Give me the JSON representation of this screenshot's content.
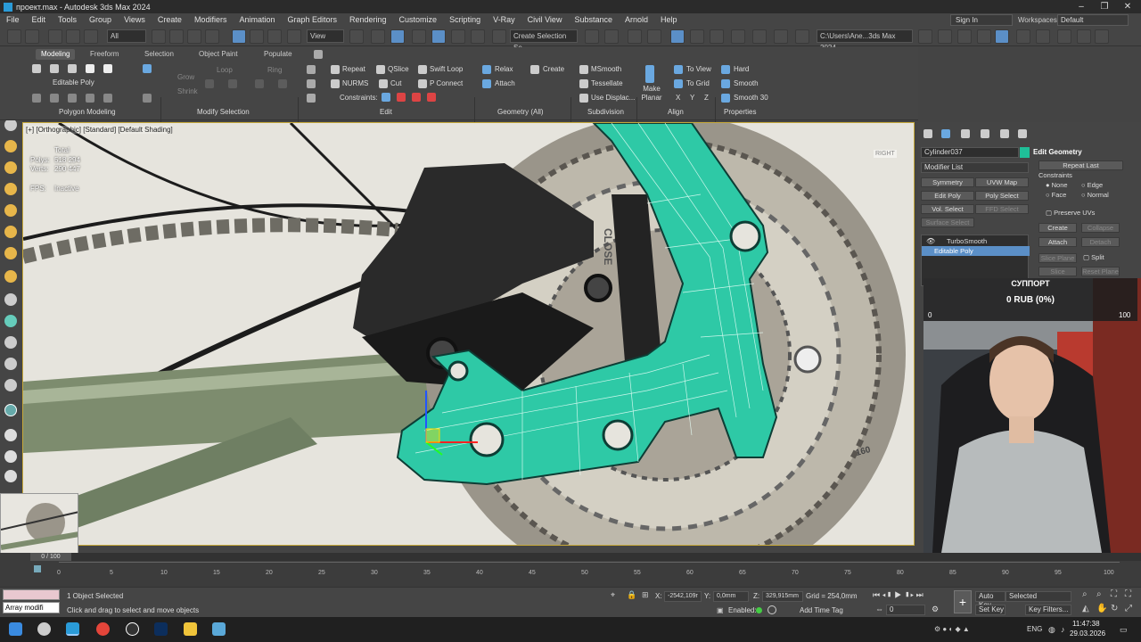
{
  "window": {
    "title": "проект.max - Autodesk 3ds Max 2024",
    "minimize": "–",
    "restore": "❐",
    "close": "✕"
  },
  "menu": [
    "File",
    "Edit",
    "Tools",
    "Group",
    "Views",
    "Create",
    "Modifiers",
    "Animation",
    "Graph Editors",
    "Rendering",
    "Customize",
    "Scripting",
    "V-Ray",
    "Civil View",
    "Substance",
    "Arnold",
    "Help"
  ],
  "account": {
    "sign_in": "Sign In",
    "workspaces_label": "Workspaces:",
    "workspace": "Default"
  },
  "toolbar": {
    "selection_filter": "All",
    "ref_coord": "View",
    "named_selection": "Create Selection Se",
    "project_path": "C:\\Users\\Ane...3ds Max 2024"
  },
  "ribbon": {
    "tabs": [
      "Modeling",
      "Freeform",
      "Selection",
      "Object Paint",
      "Populate"
    ],
    "polygon_modeling": {
      "object_type": "Editable Poly",
      "section": "Polygon Modeling"
    },
    "modify_selection": {
      "grow": "Grow",
      "shrink": "Shrink",
      "loop": "Loop",
      "ring": "Ring",
      "section": "Modify Selection"
    },
    "edit": {
      "repeat": "Repeat",
      "qslice": "QSlice",
      "swift_loop": "Swift Loop",
      "nurms": "NURMS",
      "cut": "Cut",
      "p_connect": "P Connect",
      "constraints": "Constraints:",
      "section": "Edit"
    },
    "geometry": {
      "relax": "Relax",
      "create": "Create",
      "attach": "Attach",
      "section": "Geometry (All)"
    },
    "subdivision": {
      "msmooth": "MSmooth",
      "tessellate": "Tessellate",
      "use_displac": "Use Displac...",
      "section": "Subdivision"
    },
    "align": {
      "make_planar": "Make Planar",
      "to_view": "To View",
      "to_grid": "To Grid",
      "x": "X",
      "y": "Y",
      "z": "Z",
      "section": "Align"
    },
    "properties": {
      "hard": "Hard",
      "smooth": "Smooth",
      "smooth30": "Smooth 30",
      "section": "Properties"
    }
  },
  "viewport": {
    "label": "[+] [Orthographic] [Standard] [Default Shading]",
    "stats": {
      "total": "Total",
      "polys_label": "Polys:",
      "polys": "518 294",
      "verts_label": "Verts:",
      "verts": "290 447",
      "fps_label": "FPS:",
      "fps": "Inactive"
    },
    "viewcube": "RIGHT",
    "part_text": "CLOSE",
    "cog_text": "160"
  },
  "command_panel": {
    "object_name": "Cylinder037",
    "modifier_list": "Modifier List",
    "buttons": [
      "Symmetry",
      "UVW Map",
      "Edit Poly",
      "Poly Select",
      "Vol. Select",
      "FFD Select",
      "Surface Select"
    ],
    "stack": [
      {
        "label": "TurboSmooth",
        "selected": false
      },
      {
        "label": "Editable Poly",
        "selected": true
      }
    ],
    "rollout": {
      "title": "Edit Geometry",
      "repeat_last": "Repeat Last",
      "constraints": "Constraints",
      "none": "None",
      "edge": "Edge",
      "face": "Face",
      "normal": "Normal",
      "preserve_uvs": "Preserve UVs",
      "create": "Create",
      "collapse": "Collapse",
      "attach": "Attach",
      "detach": "Detach",
      "slice_plane": "Slice Plane",
      "split": "Split",
      "slice": "Slice",
      "reset_plane": "Reset Plane"
    },
    "object_color": "#1fbf98"
  },
  "stream": {
    "donation_title": "СУППОРТ",
    "donation_amount": "0 RUB (0%)",
    "min": "0",
    "max": "100"
  },
  "timeline": {
    "frame": "0 / 100",
    "ticks": [
      "0",
      "5",
      "10",
      "15",
      "20",
      "25",
      "30",
      "35",
      "40",
      "45",
      "50",
      "55",
      "60",
      "65",
      "70",
      "75",
      "80",
      "85",
      "90",
      "95",
      "100"
    ]
  },
  "status": {
    "selected": "1 Object Selected",
    "prompt": "Click and drag to select and move objects",
    "maxscript": "Array modifi",
    "x_label": "X:",
    "x": "-2542,109r",
    "y_label": "Y:",
    "y": "0,0mm",
    "z_label": "Z:",
    "z": "329,915mm",
    "grid": "Grid = 254,0mm",
    "enabled": "Enabled:",
    "add_time_tag": "Add Time Tag",
    "auto_key": "Auto Key",
    "set_key": "Set Key",
    "key_mode": "Selected",
    "key_filters": "Key Filters...",
    "frame_field": "0"
  },
  "taskbar": {
    "time": "11:47:38",
    "date": "29.03.2026",
    "lang": "ENG"
  }
}
